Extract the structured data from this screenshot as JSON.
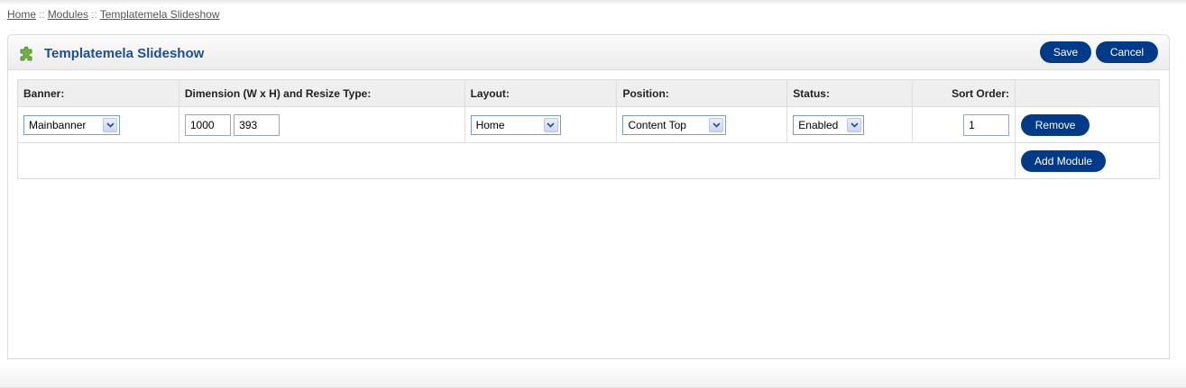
{
  "breadcrumb": {
    "items": [
      "Home",
      "Modules",
      "Templatemela Slideshow"
    ],
    "separator": "::"
  },
  "header": {
    "icon": "puzzle-piece-icon",
    "title": "Templatemela Slideshow",
    "save_label": "Save",
    "cancel_label": "Cancel"
  },
  "table": {
    "columns": [
      "Banner:",
      "Dimension (W x H) and Resize Type:",
      "Layout:",
      "Position:",
      "Status:",
      "Sort Order:"
    ],
    "rows": [
      {
        "banner": "Mainbanner",
        "width": "1000",
        "height": "393",
        "layout": "Home",
        "position": "Content Top",
        "status": "Enabled",
        "sort_order": "1",
        "remove_label": "Remove"
      }
    ],
    "add_module_label": "Add Module"
  },
  "colors": {
    "button": "#003a88",
    "title": "#1d4f8f",
    "icon": "#6cb33f"
  }
}
